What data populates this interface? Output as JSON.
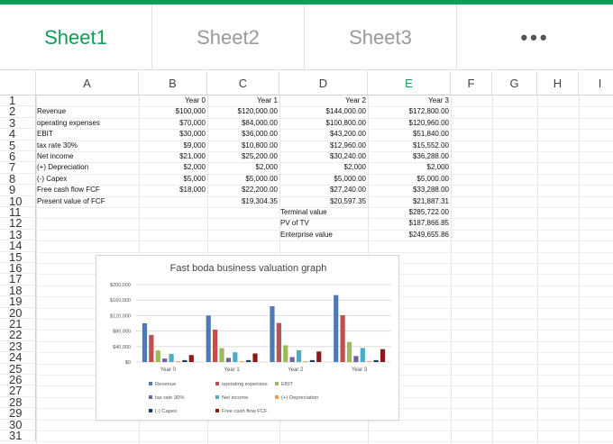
{
  "tabs": [
    {
      "label": "Sheet1",
      "active": true
    },
    {
      "label": "Sheet2",
      "active": false
    },
    {
      "label": "Sheet3",
      "active": false
    }
  ],
  "more_menu": "•••",
  "columns": [
    "A",
    "B",
    "C",
    "D",
    "E",
    "F",
    "G",
    "H",
    "I"
  ],
  "selected_column": "E",
  "rows": [
    [
      "",
      "Year 0",
      "Year 1",
      "Year 2",
      "Year 3"
    ],
    [
      "Revenue",
      "$100,000",
      "$120,000.00",
      "$144,000.00",
      "$172,800.00"
    ],
    [
      "operating expenses",
      "$70,000",
      "$84,000.00",
      "$100,800.00",
      "$120,960.00"
    ],
    [
      "EBIT",
      "$30,000",
      "$36,000.00",
      "$43,200.00",
      "$51,840.00"
    ],
    [
      "tax rate 30%",
      "$9,000",
      "$10,800.00",
      "$12,960.00",
      "$15,552.00"
    ],
    [
      "Net income",
      "$21,000",
      "$25,200.00",
      "$30,240.00",
      "$36,288.00"
    ],
    [
      "(+) Depreciation",
      "$2,000",
      "$2,000",
      "$2,000",
      "$2,000"
    ],
    [
      "(-) Capex",
      "$5,000",
      "$5,000.00",
      "$5,000.00",
      "$5,000.00"
    ],
    [
      "Free cash flow FCF",
      "$18,000",
      "$22,200.00",
      "$27,240.00",
      "$33,288.00"
    ],
    [
      "Present value of FCF",
      "",
      "$19,304.35",
      "$20,597.35",
      "$21,887.31"
    ],
    [
      "",
      "",
      "",
      "Terminal value",
      "$285,722.00"
    ],
    [
      "",
      "",
      "",
      "PV of TV",
      "$187,866.85"
    ],
    [
      "",
      "",
      "",
      "Enterprise value",
      "$249,655.86"
    ]
  ],
  "row_count": 31,
  "chart_data": {
    "type": "bar",
    "title": "Fast boda business valuation graph",
    "categories": [
      "Year 0",
      "Year 1",
      "Year 2",
      "Year 3"
    ],
    "ylim": [
      0,
      200000
    ],
    "yticks": [
      "$0",
      "$40,000",
      "$80,000",
      "$120,000",
      "$160,000",
      "$200,000"
    ],
    "ytick_values": [
      0,
      40000,
      80000,
      120000,
      160000,
      200000
    ],
    "grid": true,
    "legend_position": "bottom",
    "series": [
      {
        "name": "Revenue",
        "color": "#4e79b7",
        "values": [
          100000,
          120000,
          144000,
          172800
        ]
      },
      {
        "name": "operating expenses",
        "color": "#c0504d",
        "values": [
          70000,
          84000,
          100800,
          120960
        ]
      },
      {
        "name": "EBIT",
        "color": "#9bbb59",
        "values": [
          30000,
          36000,
          43200,
          51840
        ]
      },
      {
        "name": "tax rate 30%",
        "color": "#7063a0",
        "values": [
          9000,
          10800,
          12960,
          15552
        ]
      },
      {
        "name": "Net income",
        "color": "#4bacc6",
        "values": [
          21000,
          25200,
          30240,
          36288
        ]
      },
      {
        "name": "(+) Depreciation",
        "color": "#f79646",
        "values": [
          2000,
          2000,
          2000,
          2000
        ]
      },
      {
        "name": "(-) Capex",
        "color": "#1f3864",
        "values": [
          5000,
          5000,
          5000,
          5000
        ]
      },
      {
        "name": "Free cash flow FCF",
        "color": "#8b1a1a",
        "values": [
          18000,
          22200,
          27240,
          33288
        ]
      }
    ]
  }
}
